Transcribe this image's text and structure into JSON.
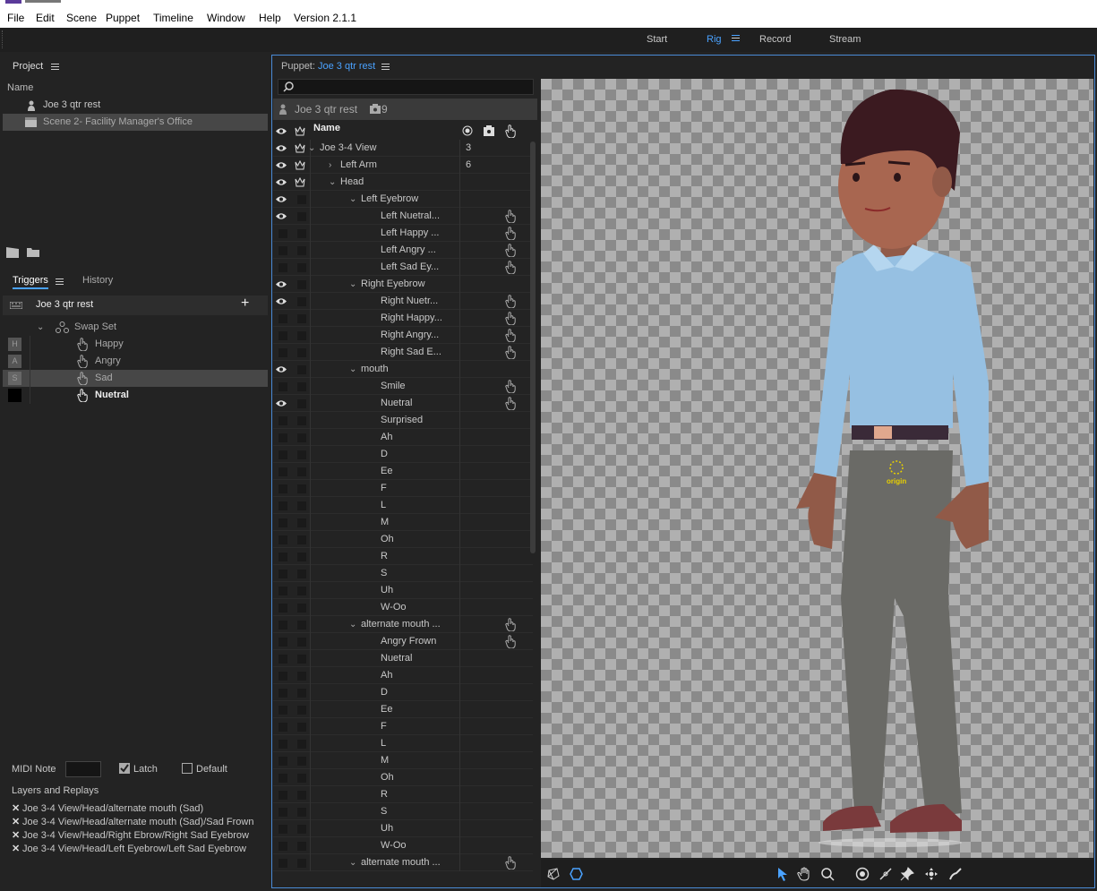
{
  "menubar": {
    "items": [
      "File",
      "Edit",
      "Scene",
      "Puppet",
      "Timeline",
      "Window",
      "Help",
      "Version 2.1.1"
    ]
  },
  "workspaces": {
    "tabs": [
      "Start",
      "Rig",
      "Record",
      "Stream"
    ],
    "active": "Rig"
  },
  "project": {
    "title": "Project",
    "column": "Name",
    "items": [
      {
        "label": "Joe 3 qtr rest",
        "icon": "puppet-icon"
      },
      {
        "label": "Scene 2- Facility Manager's Office",
        "icon": "scene-icon",
        "selected": true
      }
    ]
  },
  "triggers": {
    "tabs": [
      "Triggers",
      "History"
    ],
    "puppet": "Joe 3 qtr rest",
    "swapset": "Swap Set",
    "items": [
      {
        "key": "H",
        "label": "Happy"
      },
      {
        "key": "A",
        "label": "Angry"
      },
      {
        "key": "S",
        "label": "Sad",
        "selected": true
      },
      {
        "key": "",
        "label": "Nuetral",
        "bold": true
      }
    ]
  },
  "trigger_detail": {
    "midi_label": "MIDI Note",
    "latch_label": "Latch",
    "latch_checked": true,
    "default_label": "Default",
    "default_checked": false,
    "layers_title": "Layers and Replays",
    "layers": [
      "Joe 3-4 View/Head/alternate mouth (Sad)",
      "Joe 3-4 View/Head/alternate mouth (Sad)/Sad Frown",
      "Joe 3-4 View/Head/Right Ebrow/Right Sad Eyebrow",
      "Joe 3-4 View/Head/Left Eyebrow/Left Sad Eyebrow"
    ]
  },
  "puppet_panel": {
    "title_prefix": "Puppet:",
    "title_name": "Joe 3 qtr rest",
    "header_name": "Joe 3 qtr rest",
    "header_count": "9",
    "col_name": "Name",
    "origin_label": "origin"
  },
  "layers": [
    {
      "name": "Joe 3-4 View",
      "indent": 0,
      "chev": "down",
      "eye": true,
      "crown": true,
      "num": "3"
    },
    {
      "name": "Left Arm",
      "indent": 1,
      "chev": "right",
      "eye": true,
      "crown": true,
      "num": "6"
    },
    {
      "name": "Head",
      "indent": 1,
      "chev": "down",
      "eye": true,
      "crown": true
    },
    {
      "name": "Left Eyebrow",
      "indent": 2,
      "chev": "down",
      "eye": true
    },
    {
      "name": "Left Nuetral...",
      "indent": 3,
      "eye": true,
      "hand": true
    },
    {
      "name": "Left Happy ...",
      "indent": 3,
      "hand": true
    },
    {
      "name": "Left Angry ...",
      "indent": 3,
      "hand": true
    },
    {
      "name": "Left Sad Ey...",
      "indent": 3,
      "hand": true
    },
    {
      "name": "Right Eyebrow",
      "indent": 2,
      "chev": "down",
      "eye": true
    },
    {
      "name": "Right Nuetr...",
      "indent": 3,
      "eye": true,
      "hand": true
    },
    {
      "name": "Right Happy...",
      "indent": 3,
      "hand": true
    },
    {
      "name": "Right Angry...",
      "indent": 3,
      "hand": true
    },
    {
      "name": "Right Sad E...",
      "indent": 3,
      "hand": true
    },
    {
      "name": "mouth",
      "indent": 2,
      "chev": "down",
      "eye": true
    },
    {
      "name": "Smile",
      "indent": 3,
      "hand": true
    },
    {
      "name": "Nuetral",
      "indent": 3,
      "eye": true,
      "hand": true
    },
    {
      "name": "Surprised",
      "indent": 3
    },
    {
      "name": "Ah",
      "indent": 3
    },
    {
      "name": "D",
      "indent": 3
    },
    {
      "name": "Ee",
      "indent": 3
    },
    {
      "name": "F",
      "indent": 3
    },
    {
      "name": "L",
      "indent": 3
    },
    {
      "name": "M",
      "indent": 3
    },
    {
      "name": "Oh",
      "indent": 3
    },
    {
      "name": "R",
      "indent": 3
    },
    {
      "name": "S",
      "indent": 3
    },
    {
      "name": "Uh",
      "indent": 3
    },
    {
      "name": "W-Oo",
      "indent": 3
    },
    {
      "name": "alternate mouth ...",
      "indent": 2,
      "chev": "down",
      "hand": true
    },
    {
      "name": "Angry Frown",
      "indent": 3,
      "hand": true
    },
    {
      "name": "Nuetral",
      "indent": 3
    },
    {
      "name": "Ah",
      "indent": 3
    },
    {
      "name": "D",
      "indent": 3
    },
    {
      "name": "Ee",
      "indent": 3
    },
    {
      "name": "F",
      "indent": 3
    },
    {
      "name": "L",
      "indent": 3
    },
    {
      "name": "M",
      "indent": 3
    },
    {
      "name": "Oh",
      "indent": 3
    },
    {
      "name": "R",
      "indent": 3
    },
    {
      "name": "S",
      "indent": 3
    },
    {
      "name": "Uh",
      "indent": 3
    },
    {
      "name": "W-Oo",
      "indent": 3
    },
    {
      "name": "alternate mouth ...",
      "indent": 2,
      "chev": "down",
      "hand": true
    }
  ],
  "colors": {
    "accent": "#4aa2ff",
    "panel_bg": "#232323",
    "selection": "#474747"
  },
  "icons": [
    "clapper-icon",
    "folder-icon",
    "keyboard-icon",
    "plus-icon",
    "search-icon",
    "eye-icon",
    "crown-icon",
    "handle-icon",
    "camera-icon",
    "hand-icon",
    "select-arrow-icon",
    "zoom-icon",
    "origin-icon",
    "dragger-icon",
    "pin-icon",
    "stick-icon"
  ]
}
